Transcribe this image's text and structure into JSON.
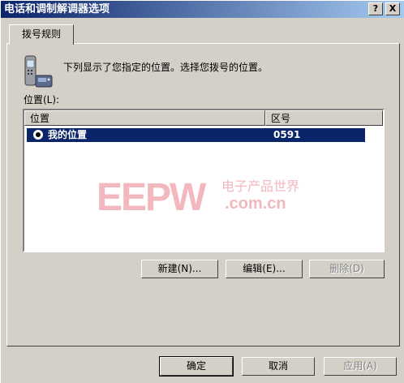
{
  "window": {
    "title": "电话和调制解调器选项",
    "help_glyph": "?",
    "close_glyph": "X"
  },
  "tab": {
    "label": "拨号规则"
  },
  "description": "下列显示了您指定的位置。选择您拨号的位置。",
  "list_label": "位置(L):",
  "columns": {
    "location": "位置",
    "area_code": "区号"
  },
  "rows": [
    {
      "location": "我的位置",
      "area_code": "0591",
      "selected": true
    }
  ],
  "buttons": {
    "new": "新建(N)...",
    "edit": "编辑(E)...",
    "delete": "删除(D)",
    "ok": "确定",
    "cancel": "取消",
    "apply": "应用(A)"
  },
  "watermark": {
    "brand": "EEPW",
    "site": "电子产品世界",
    "domain": ".com.cn",
    "color": "#e63946"
  },
  "colors": {
    "title_start": "#0a246a",
    "title_end": "#a6caf0",
    "selection": "#0a246a",
    "face": "#d4d0c8"
  }
}
